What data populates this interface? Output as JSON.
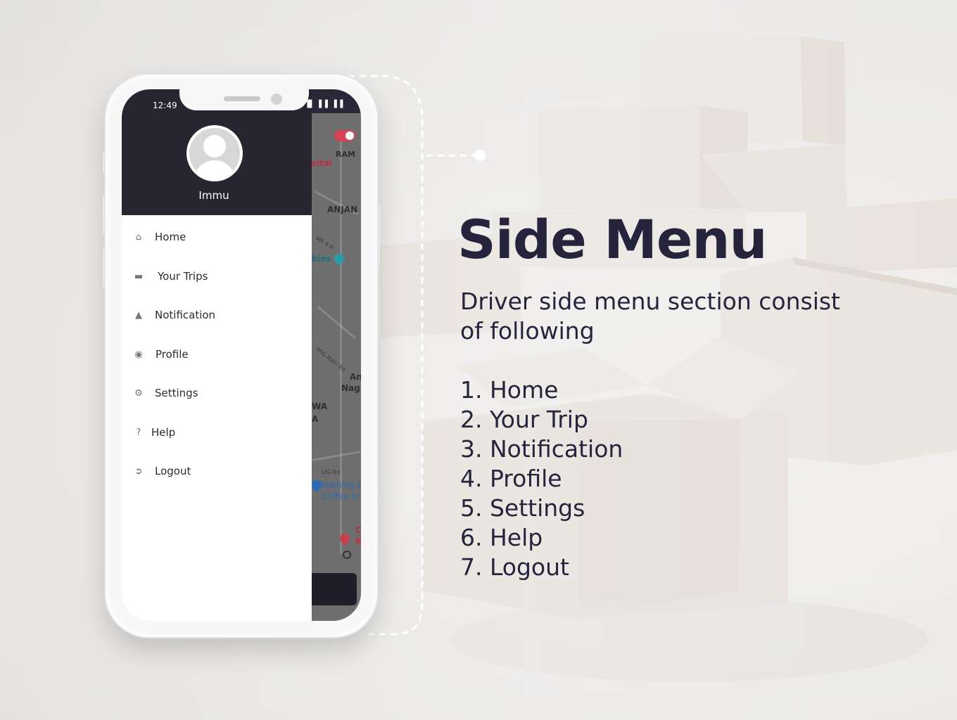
{
  "phone": {
    "status_time": "12:49",
    "status_icons": "∙ ▉ ▐▐ ▐▐",
    "user_name": "Immu",
    "menu_items": [
      {
        "label": "Home",
        "icon": "home-icon"
      },
      {
        "label": "Your Trips",
        "icon": "truck-icon"
      },
      {
        "label": "Notification",
        "icon": "bell-icon"
      },
      {
        "label": "Profile",
        "icon": "user-circle-icon"
      },
      {
        "label": "Settings",
        "icon": "gear-icon"
      },
      {
        "label": "Help",
        "icon": "question-icon"
      },
      {
        "label": "Logout",
        "icon": "logout-icon"
      }
    ],
    "map_labels": {
      "ram": "RAM",
      "pital": "pital",
      "anjan": "ANJAN",
      "mr9": "MR 9 R",
      "kies": "kies",
      "mig": "MIG Main Rd",
      "an": "An",
      "nag": "Nag",
      "wa": "WA",
      "a": "A",
      "lig": "LIG Rd",
      "nothing": "Nothing E",
      "coffee": "Coffee In",
      "c": "C",
      "r": "R"
    }
  },
  "panel": {
    "title": "Side Menu",
    "subtitle": "Driver side menu section consist of following",
    "list": [
      "1. Home",
      "2. Your Trip",
      "3. Notification",
      "4. Profile",
      "5. Settings",
      "6. Help",
      "7. Logout"
    ]
  },
  "colors": {
    "drawer_header": "#27252f",
    "title_text": "#26233d",
    "toggle_accent": "#d8435a"
  }
}
